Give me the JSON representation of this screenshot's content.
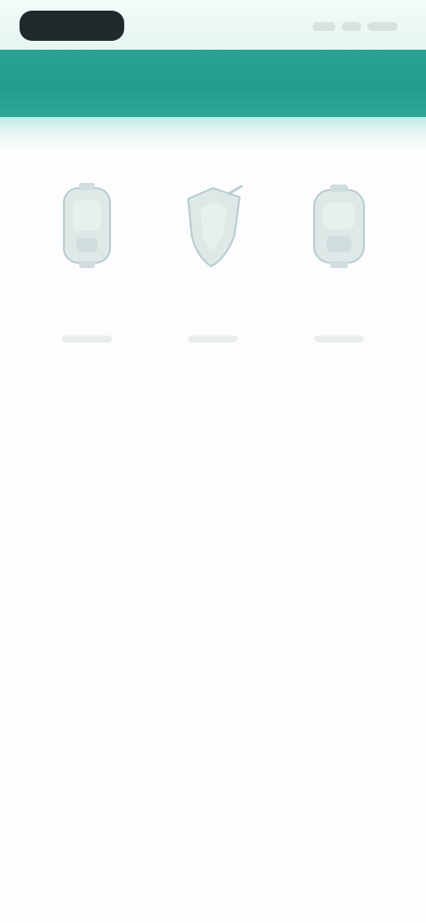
{
  "status_bar": {
    "time": "",
    "icons": [
      "signal-icon",
      "wifi-icon",
      "battery-icon"
    ]
  },
  "header": {
    "title": "",
    "color": "#239c8d"
  },
  "options": [
    {
      "icon": "device-icon",
      "label": ""
    },
    {
      "icon": "shield-icon",
      "label": ""
    },
    {
      "icon": "device-icon",
      "label": ""
    }
  ],
  "colors": {
    "accent": "#239c8d",
    "icon_fill": "#dde8e7",
    "icon_stroke": "#b7cdcb"
  }
}
